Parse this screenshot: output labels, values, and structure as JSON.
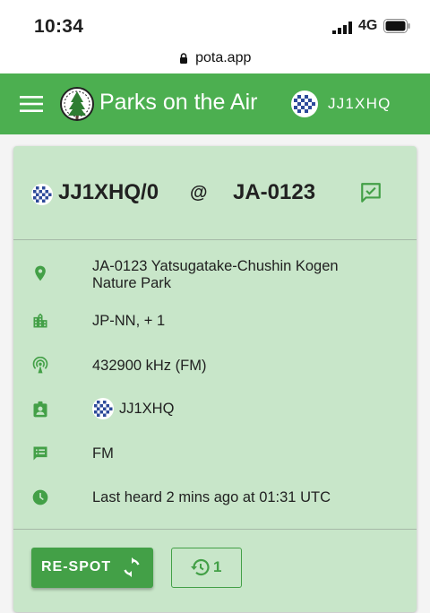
{
  "status_bar": {
    "time": "10:34",
    "network": "4G",
    "icons": [
      "signal-icon",
      "battery-icon"
    ]
  },
  "browser": {
    "url": "pota.app",
    "icon": "lock-icon"
  },
  "app_bar": {
    "title": "Parks on the Air",
    "user_callsign": "JJ1XHQ",
    "icons": [
      "menu-icon",
      "pota-logo",
      "user-avatar"
    ],
    "color": "#4caf50"
  },
  "spot": {
    "activator": "JJ1XHQ/0",
    "at": "@",
    "reference": "JA-0123",
    "park_line1": "JA-0123  Yatsugatake-Chushin Kogen",
    "park_line2": "Nature Park",
    "location": "JP-NN, + 1",
    "frequency": "432900 kHz (FM)",
    "spotter": "JJ1XHQ",
    "comment": "FM",
    "last_heard": "Last heard 2 mins ago at 01:31 UTC",
    "icons": [
      "place-icon",
      "location-city-icon",
      "antenna-icon",
      "spotter-badge-icon",
      "comment-icon",
      "clock-icon",
      "spot-check-icon"
    ]
  },
  "actions": {
    "respot_label": "RE-SPOT",
    "history_count": "1",
    "icons": [
      "refresh-icon",
      "history-icon"
    ]
  },
  "colors": {
    "card_bg": "#c8e6c9",
    "accent": "#43a047",
    "icon_green": "#43a047"
  }
}
